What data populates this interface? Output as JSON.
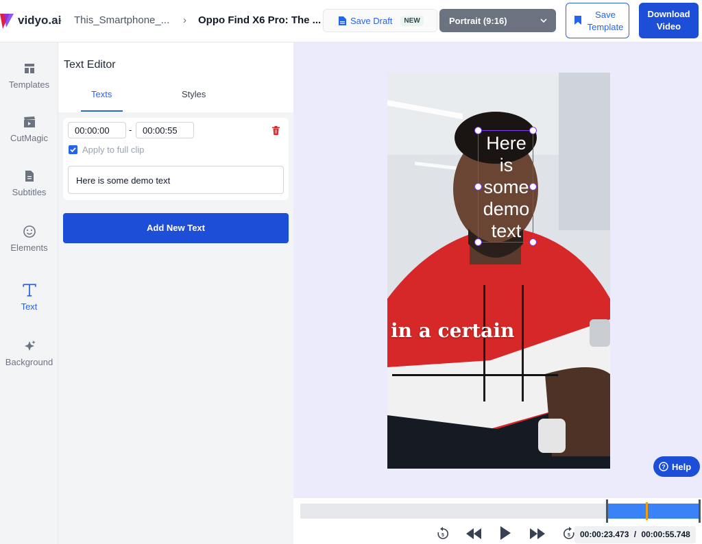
{
  "header": {
    "brand": "vidyo.ai",
    "breadcrumb": [
      "This_Smartphone_...",
      "Oppo Find X6 Pro: The ..."
    ],
    "save_draft": {
      "label": "Save Draft",
      "badge": "NEW"
    },
    "aspect_ratio": {
      "selected": "Portrait (9:16)"
    },
    "save_template": {
      "label": "Save Template"
    },
    "download": {
      "label": "Download Video"
    }
  },
  "sidebar": {
    "items": [
      {
        "label": "Templates",
        "icon": "layout-icon"
      },
      {
        "label": "CutMagic",
        "icon": "clapperboard-icon"
      },
      {
        "label": "Subtitles",
        "icon": "document-icon"
      },
      {
        "label": "Elements",
        "icon": "smiley-icon"
      },
      {
        "label": "Text",
        "icon": "text-t-icon",
        "active": true
      },
      {
        "label": "Background",
        "icon": "sparkle-icon"
      }
    ]
  },
  "editor": {
    "title": "Text Editor",
    "tabs": [
      {
        "label": "Texts",
        "active": true
      },
      {
        "label": "Styles"
      }
    ],
    "text_entry": {
      "start_time": "00:00:00",
      "separator": "-",
      "end_time": "00:00:55",
      "apply_full_clip": {
        "label": "Apply to full clip",
        "checked": true
      },
      "text": "Here is some demo text"
    },
    "add_button": "Add New Text"
  },
  "preview": {
    "overlay_text": "Here\nis\nsome\ndemo\ntext",
    "subtitle_text": "in a certain",
    "help_label": "Help"
  },
  "timeline": {
    "current_time": "00:00:23.473",
    "separator": "/",
    "total_time": "00:00:55.748",
    "progress": 0.421
  },
  "colors": {
    "accent": "#1d4ed8",
    "selection": "#7c3aed",
    "canvas_bg": "#ecebfb"
  }
}
